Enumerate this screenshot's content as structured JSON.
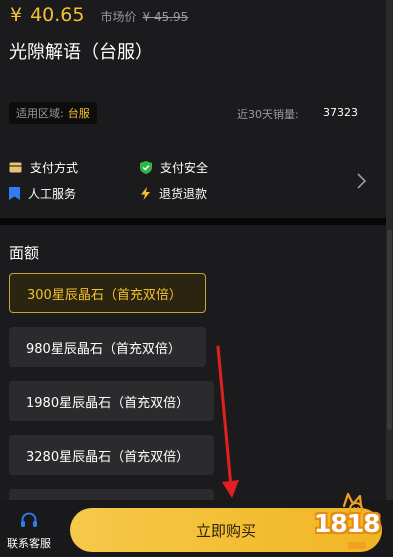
{
  "product": {
    "price_symbol": "¥",
    "price": "40.65",
    "market_label": "市场价",
    "market_price": "¥ 45.95",
    "title": "光隙解语（台服）"
  },
  "region": {
    "label": "适用区域:",
    "value": "台服"
  },
  "sales": {
    "label": "近30天销量:",
    "value": "37323"
  },
  "features": [
    {
      "label": "支付方式",
      "icon": "card-icon"
    },
    {
      "label": "支付安全",
      "icon": "shield-icon"
    },
    {
      "label": "人工服务",
      "icon": "bookmark-icon"
    },
    {
      "label": "退货退款",
      "icon": "lightning-icon"
    }
  ],
  "section": {
    "title": "面额"
  },
  "options": [
    {
      "label": "300星辰晶石（首充双倍）",
      "selected": true
    },
    {
      "label": "980星辰晶石（首充双倍）",
      "selected": false
    },
    {
      "label": "1980星辰晶石（首充双倍）",
      "selected": false
    },
    {
      "label": "3280星辰晶石（首充双倍）",
      "selected": false
    }
  ],
  "bottom": {
    "customer_service": "联系客服",
    "buy": "立即购买"
  },
  "watermark": {
    "text": "1818"
  },
  "colors": {
    "accent": "#f2c230",
    "background": "#1b1b1d",
    "option_bg": "#2b2b2e",
    "arrow": "#e02020"
  }
}
